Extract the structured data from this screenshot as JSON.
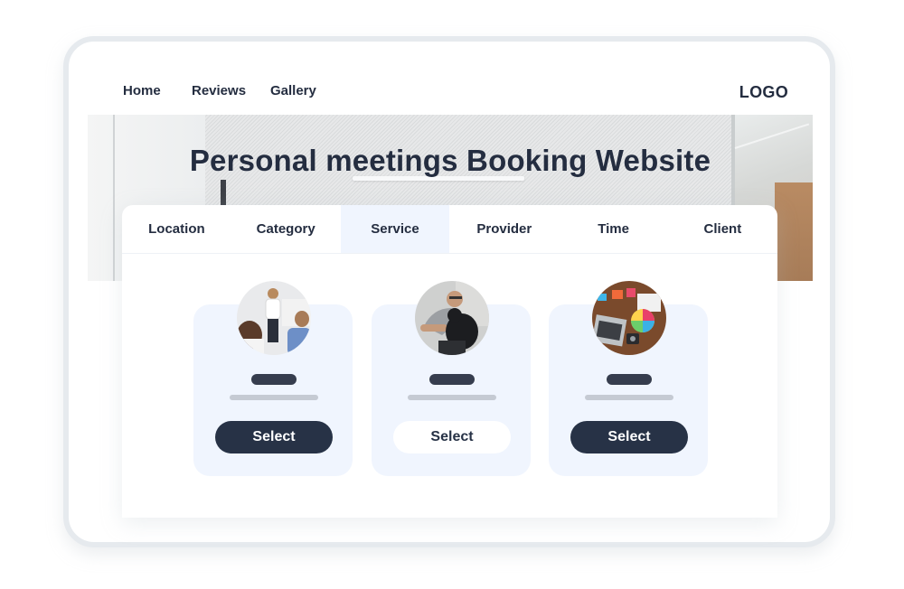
{
  "nav": {
    "links": [
      "Home",
      "Reviews",
      "Gallery"
    ],
    "logo": "LOGO"
  },
  "hero": {
    "title": "Personal meetings Booking Website"
  },
  "booking": {
    "tabs": [
      {
        "label": "Location",
        "active": false
      },
      {
        "label": "Category",
        "active": false
      },
      {
        "label": "Service",
        "active": true
      },
      {
        "label": "Provider",
        "active": false
      },
      {
        "label": "Time",
        "active": false
      },
      {
        "label": "Client",
        "active": false
      }
    ],
    "services": [
      {
        "image": "presentation-photo",
        "button_label": "Select",
        "button_style": "dark"
      },
      {
        "image": "man-with-dog-photo",
        "button_label": "Select",
        "button_style": "light"
      },
      {
        "image": "design-desk-photo",
        "button_label": "Select",
        "button_style": "dark"
      }
    ]
  },
  "colors": {
    "primary": "#273246",
    "tab_active_bg": "#f0f5fe",
    "card_bg": "#f0f5fe",
    "frame": "#e6eaee"
  }
}
